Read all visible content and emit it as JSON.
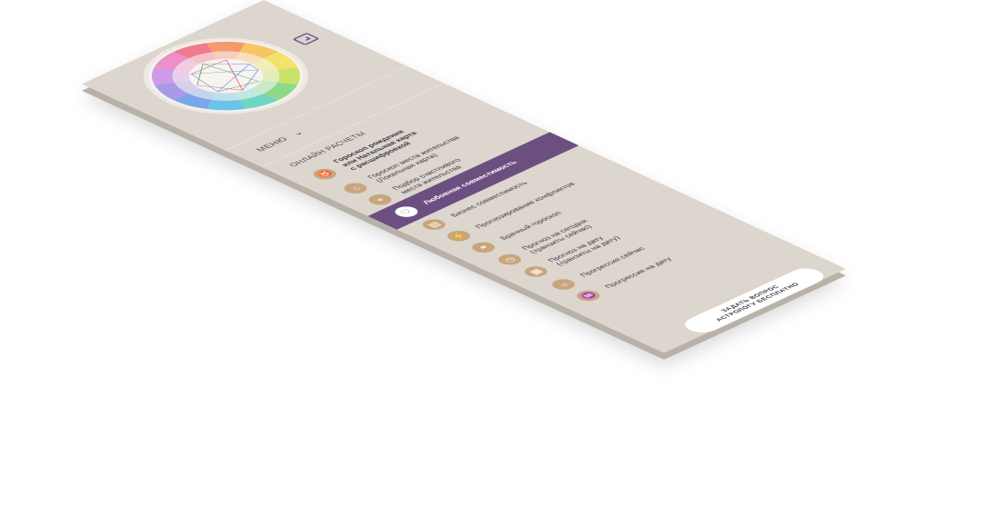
{
  "expand_icon": "expand-icon",
  "menu": {
    "label": "МЕНЮ",
    "icon": "chevron-down-icon"
  },
  "calculations": {
    "title": "ОНЛАЙН РАСЧЕТЫ",
    "items": [
      {
        "label": "Гороскоп рождения\nили Натальная карта\nс расшифровкой",
        "icon": "natal-chart-icon",
        "bold": true
      },
      {
        "label": "Гороскоп места жительства\n(Локальная карта)",
        "icon": "house-icon"
      },
      {
        "label": "Подбор счастливого\nместа жительства",
        "icon": "location-icon"
      },
      {
        "label": "Любовная совместимость",
        "icon": "heart-icon",
        "active": true
      },
      {
        "label": "Бизнес совместимость",
        "icon": "briefcase-icon"
      },
      {
        "label": "Прогнозирование конфликтов",
        "icon": "conflict-icon"
      },
      {
        "label": "Брачный гороскоп",
        "icon": "rings-icon"
      },
      {
        "label": "Прогноз на сегодня\n(транзиты сейчас)",
        "icon": "clock-icon"
      },
      {
        "label": "Прогноз на дату\n(транзиты на дату)",
        "icon": "calendar-icon"
      },
      {
        "label": "Прогрессия сейчас",
        "icon": "sun-icon"
      },
      {
        "label": "Прогрессия на дату",
        "icon": "progression-icon"
      }
    ]
  },
  "cta": {
    "line1": "ЗАДАТЬ ВОПРОС",
    "line2": "АСТРОЛОГУ БЕСПЛАТНО"
  },
  "colors": {
    "panel": "#dcd6ce",
    "active": "#6c4f80",
    "icon_bg": "#c9a57c",
    "text": "#3d3745"
  }
}
